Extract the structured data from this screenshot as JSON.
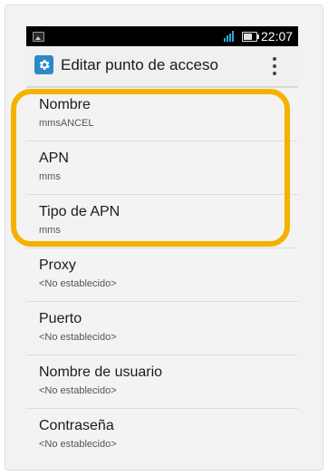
{
  "status_bar": {
    "time": "22:07",
    "colors": {
      "background": "#000000",
      "signal": "#27a8e0"
    }
  },
  "action_bar": {
    "title": "Editar punto de acceso",
    "app_icon": "settings-gear-icon",
    "overflow_icon": "more-vert-icon"
  },
  "apn_fields": [
    {
      "label": "Nombre",
      "value": "mmsANCEL"
    },
    {
      "label": "APN",
      "value": "mms"
    },
    {
      "label": "Tipo de APN",
      "value": "mms"
    },
    {
      "label": "Proxy",
      "value": "<No establecido>"
    },
    {
      "label": "Puerto",
      "value": "<No establecido>"
    },
    {
      "label": "Nombre de usuario",
      "value": "<No establecido>"
    },
    {
      "label": "Contraseña",
      "value": "<No establecido>"
    }
  ],
  "highlight": {
    "color": "#f5b100"
  }
}
